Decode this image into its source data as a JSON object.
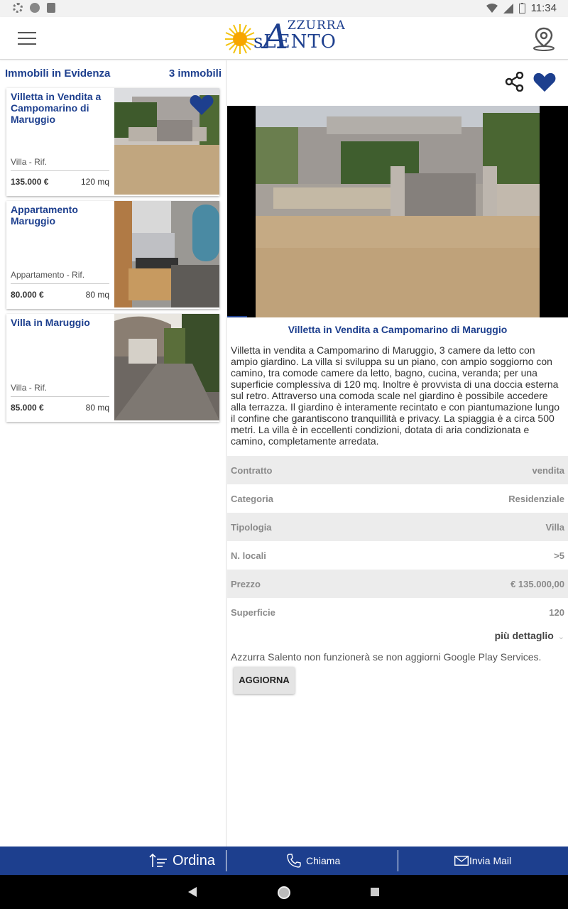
{
  "status_bar": {
    "time": "11:34"
  },
  "app": {
    "logo_top": "ZZURRA",
    "logo_big": "A",
    "logo_bottom": "sLENTO",
    "menu_icon": "hamburger-icon",
    "location_icon": "map-pin-icon",
    "brand_color": "#1d3f8e"
  },
  "list": {
    "title": "Immobili in Evidenza",
    "count": "3 immobili",
    "items": [
      {
        "title": "Villetta in Vendita a Campomarino di Maruggio",
        "ref": "Villa - Rif.",
        "price": "135.000 €",
        "area": "120 mq",
        "favorite": true
      },
      {
        "title": "Appartamento Maruggio",
        "ref": "Appartamento - Rif.",
        "price": "80.000 €",
        "area": "80 mq",
        "favorite": false
      },
      {
        "title": "Villa in Maruggio",
        "ref": "Villa - Rif.",
        "price": "85.000 €",
        "area": "80 mq",
        "favorite": false
      }
    ]
  },
  "detail": {
    "title": "Villetta in Vendita a Campomarino di Maruggio",
    "description": "Villetta in vendita a Campomarino di Maruggio, 3 camere da letto con ampio giardino. La villa si sviluppa su un piano, con ampio soggiorno con camino, tra comode camere da letto, bagno, cucina, veranda; per una superficie complessiva di 120 mq. Inoltre è provvista di una doccia esterna sul retro. Attraverso una comoda scale nel giardino è possibile accedere alla terrazza. Il giardino è interamente recintato e con piantumazione lungo il confine che garantiscono tranquillità e privacy. La spiaggia è a circa 500 metri. La villa è in eccellenti condizioni, dotata di aria condizionata e camino, completamente arredata.",
    "specs": [
      {
        "key": "Contratto",
        "value": "vendita"
      },
      {
        "key": "Categoria",
        "value": "Residenziale"
      },
      {
        "key": "Tipologia",
        "value": "Villa"
      },
      {
        "key": "N. locali",
        "value": ">5"
      },
      {
        "key": "Prezzo",
        "value": "€ 135.000,00"
      },
      {
        "key": "Superficie",
        "value": "120"
      }
    ],
    "more_label": "più dettaglio",
    "gps_message": "Azzurra Salento non funzionerà se non aggiorni Google Play Services.",
    "update_label": "AGGIORNA"
  },
  "bottom_bar": {
    "sort_label": "Ordina",
    "call_label": "Chiama",
    "mail_label": "Invia Mail"
  }
}
